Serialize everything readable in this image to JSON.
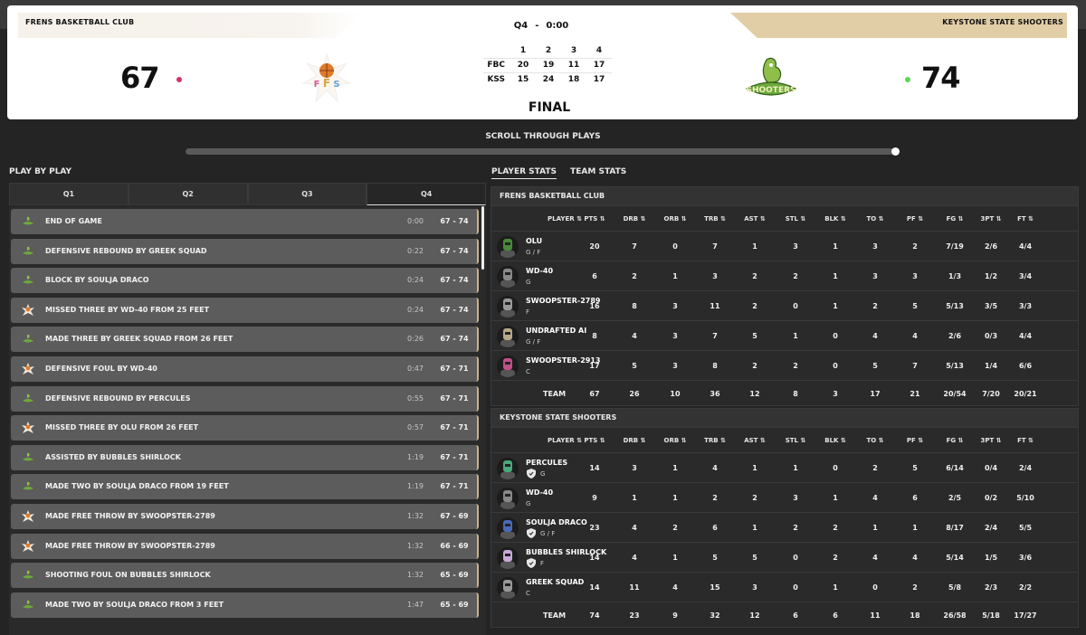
{
  "scoreboard": {
    "home_name": "FRENS BASKETBALL CLUB",
    "away_name": "KEYSTONE STATE SHOOTERS",
    "quarter": "Q4",
    "separator": "-",
    "clock": "0:00",
    "home_score": "67",
    "away_score": "74",
    "status": "FINAL",
    "home_dot_color": "#d6306a",
    "away_dot_color": "#5fd35a",
    "quarters_header": [
      "1",
      "2",
      "3",
      "4"
    ],
    "home_abbr": "FBC",
    "away_abbr": "KSS",
    "home_quarters": [
      "20",
      "19",
      "11",
      "17"
    ],
    "away_quarters": [
      "15",
      "24",
      "18",
      "17"
    ],
    "away_logo_text": "SHOOTERS"
  },
  "scroll": {
    "label": "SCROLL THROUGH PLAYS",
    "position": 1.0
  },
  "pbp": {
    "title": "PLAY BY PLAY",
    "tabs": [
      "Q1",
      "Q2",
      "Q3",
      "Q4"
    ],
    "active_tab": "Q4",
    "plays": [
      {
        "desc": "END OF GAME",
        "time": "0:00",
        "score": "67 - 74",
        "icon": "shooters-logo-icon"
      },
      {
        "desc": "DEFENSIVE REBOUND BY GREEK SQUAD",
        "time": "0:22",
        "score": "67 - 74",
        "icon": "shooters-logo-icon"
      },
      {
        "desc": "BLOCK BY SOULJA DRACO",
        "time": "0:24",
        "score": "67 - 74",
        "icon": "shooters-logo-icon"
      },
      {
        "desc": "MISSED THREE BY WD-40 FROM 25 FEET",
        "time": "0:24",
        "score": "67 - 74",
        "icon": "frens-logo-icon"
      },
      {
        "desc": "MADE THREE BY GREEK SQUAD FROM 26 FEET",
        "time": "0:26",
        "score": "67 - 74",
        "icon": "shooters-logo-icon"
      },
      {
        "desc": "DEFENSIVE FOUL BY WD-40",
        "time": "0:47",
        "score": "67 - 71",
        "icon": "frens-logo-icon"
      },
      {
        "desc": "DEFENSIVE REBOUND BY PERCULES",
        "time": "0:55",
        "score": "67 - 71",
        "icon": "shooters-logo-icon"
      },
      {
        "desc": "MISSED THREE BY OLU FROM 26 FEET",
        "time": "0:57",
        "score": "67 - 71",
        "icon": "frens-logo-icon"
      },
      {
        "desc": "ASSISTED BY BUBBLES SHIRLOCK",
        "time": "1:19",
        "score": "67 - 71",
        "icon": "shooters-logo-icon"
      },
      {
        "desc": "MADE TWO BY SOULJA DRACO FROM 19 FEET",
        "time": "1:19",
        "score": "67 - 71",
        "icon": "shooters-logo-icon"
      },
      {
        "desc": "MADE FREE THROW BY SWOOPSTER-2789",
        "time": "1:32",
        "score": "67 - 69",
        "icon": "frens-logo-icon"
      },
      {
        "desc": "MADE FREE THROW BY SWOOPSTER-2789",
        "time": "1:32",
        "score": "66 - 69",
        "icon": "frens-logo-icon"
      },
      {
        "desc": "SHOOTING FOUL ON BUBBLES SHIRLOCK",
        "time": "1:32",
        "score": "65 - 69",
        "icon": "shooters-logo-icon"
      },
      {
        "desc": "MADE TWO BY SOULJA DRACO FROM 3 FEET",
        "time": "1:47",
        "score": "65 - 69",
        "icon": "shooters-logo-icon"
      }
    ]
  },
  "stats": {
    "tabs": [
      "PLAYER STATS",
      "TEAM STATS"
    ],
    "active_tab": "PLAYER STATS",
    "columns": [
      "PLAYER ⇅",
      "PTS ⇅",
      "DRB ⇅",
      "ORB ⇅",
      "TRB ⇅",
      "AST ⇅",
      "STL ⇅",
      "BLK ⇅",
      "TO ⇅",
      "PF ⇅",
      "FG ⇅",
      "3PT ⇅",
      "FT ⇅"
    ],
    "teams": [
      {
        "name": "FRENS BASKETBALL CLUB",
        "players": [
          {
            "name": "OLU",
            "pos": "G / F",
            "shield": false,
            "avatar": "#4a8a3a",
            "stats": [
              "20",
              "7",
              "0",
              "7",
              "1",
              "3",
              "1",
              "3",
              "2",
              "7/19",
              "2/6",
              "4/4"
            ]
          },
          {
            "name": "WD-40",
            "pos": "G",
            "shield": false,
            "avatar": "#888888",
            "stats": [
              "6",
              "2",
              "1",
              "3",
              "2",
              "2",
              "1",
              "3",
              "3",
              "1/3",
              "1/2",
              "3/4"
            ]
          },
          {
            "name": "SWOOPSTER-2789",
            "pos": "F",
            "shield": false,
            "avatar": "#999999",
            "stats": [
              "16",
              "8",
              "3",
              "11",
              "2",
              "0",
              "1",
              "2",
              "5",
              "5/13",
              "3/5",
              "3/3"
            ]
          },
          {
            "name": "UNDRAFTED AI",
            "pos": "G / F",
            "shield": false,
            "avatar": "#b8a888",
            "stats": [
              "8",
              "4",
              "3",
              "7",
              "5",
              "1",
              "0",
              "4",
              "4",
              "2/6",
              "0/3",
              "4/4"
            ]
          },
          {
            "name": "SWOOPSTER-2913",
            "pos": "C",
            "shield": false,
            "avatar": "#c04f8a",
            "stats": [
              "17",
              "5",
              "3",
              "8",
              "2",
              "2",
              "0",
              "5",
              "7",
              "5/13",
              "1/4",
              "6/6"
            ]
          }
        ],
        "team_label": "TEAM",
        "totals": [
          "67",
          "26",
          "10",
          "36",
          "12",
          "8",
          "3",
          "17",
          "21",
          "20/54",
          "7/20",
          "20/21"
        ]
      },
      {
        "name": "KEYSTONE STATE SHOOTERS",
        "players": [
          {
            "name": "PERCULES",
            "pos": "G",
            "shield": true,
            "avatar": "#4aa87a",
            "stats": [
              "14",
              "3",
              "1",
              "4",
              "1",
              "1",
              "0",
              "2",
              "5",
              "6/14",
              "0/4",
              "2/4"
            ]
          },
          {
            "name": "WD-40",
            "pos": "G",
            "shield": false,
            "avatar": "#888888",
            "stats": [
              "9",
              "1",
              "1",
              "2",
              "2",
              "3",
              "1",
              "4",
              "6",
              "2/5",
              "0/2",
              "5/10"
            ]
          },
          {
            "name": "SOULJA DRACO",
            "pos": "G / F",
            "shield": true,
            "avatar": "#4a6ab8",
            "stats": [
              "23",
              "4",
              "2",
              "6",
              "1",
              "2",
              "2",
              "1",
              "1",
              "8/17",
              "2/4",
              "5/5"
            ]
          },
          {
            "name": "BUBBLES SHIRLOCK",
            "pos": "F",
            "shield": true,
            "avatar": "#c8a8d8",
            "stats": [
              "14",
              "4",
              "1",
              "5",
              "5",
              "0",
              "2",
              "4",
              "4",
              "5/14",
              "1/5",
              "3/6"
            ]
          },
          {
            "name": "GREEK SQUAD",
            "pos": "C",
            "shield": false,
            "avatar": "#999999",
            "stats": [
              "14",
              "11",
              "4",
              "15",
              "3",
              "0",
              "1",
              "0",
              "2",
              "5/8",
              "2/3",
              "2/2"
            ]
          }
        ],
        "team_label": "TEAM",
        "totals": [
          "74",
          "23",
          "9",
          "32",
          "12",
          "6",
          "6",
          "11",
          "18",
          "26/58",
          "5/18",
          "17/27"
        ]
      }
    ]
  }
}
